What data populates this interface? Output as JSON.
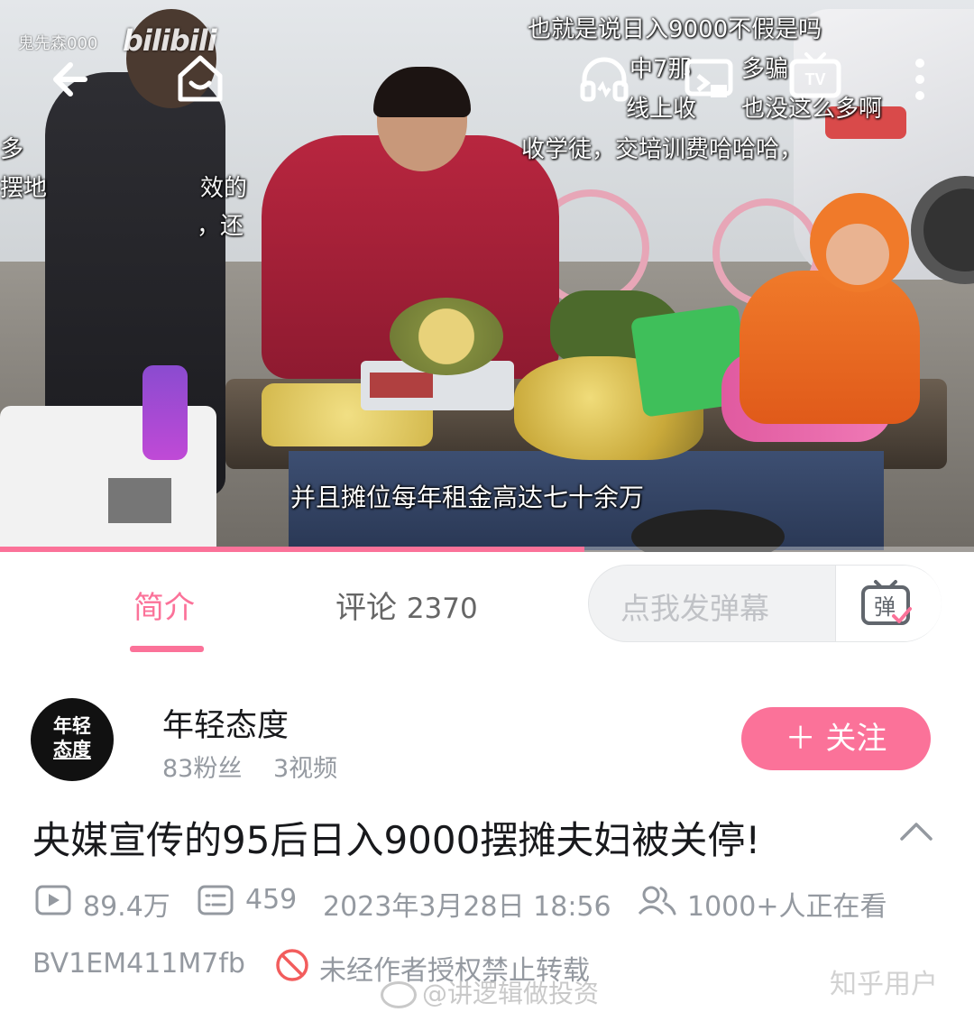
{
  "video": {
    "uploader_watermark": "鬼先森000",
    "logo_text": "bilibili",
    "subtitle": "并且摊位每年租金高达七十余万",
    "progress_fraction": 0.6,
    "danmaku": [
      "也就是说日入9000不假是吗",
      "中7那",
      "多骗",
      "线上收",
      "也没这么多啊",
      "收学徒，交培训费哈哈哈，",
      "多",
      "摆地",
      "效的",
      "，还"
    ],
    "icons": [
      "back-arrow-icon",
      "home-icon",
      "headphones-icon",
      "cast-icon",
      "tv-icon",
      "more-vertical-icon"
    ]
  },
  "tabs": {
    "intro_label": "简介",
    "comments_label": "评论",
    "comments_count": "2370"
  },
  "danmaku_input": {
    "placeholder": "点我发弹幕",
    "button_glyph": "弹"
  },
  "author": {
    "avatar_text_line1": "年轻",
    "avatar_text_line2": "态度",
    "name": "年轻态度",
    "followers": "83粉丝",
    "videos": "3视频",
    "follow_label": "＋ 关注"
  },
  "video_info": {
    "title": "央媒宣传的95后日入9000摆摊夫妇被关停!",
    "views": "89.4万",
    "danmaku_count": "459",
    "publish_time": "2023年3月28日 18:56",
    "watching": "1000+人正在看",
    "bvid": "BV1EM411M7fb",
    "reprint_notice": "未经作者授权禁止转载"
  },
  "watermarks": {
    "weibo": "@讲逻辑做投资",
    "zhihu": "知乎用户"
  },
  "colors": {
    "accent": "#fb7299",
    "text_primary": "#18191c",
    "text_secondary": "#9499a0",
    "forbidden_red": "#f25d5d"
  }
}
